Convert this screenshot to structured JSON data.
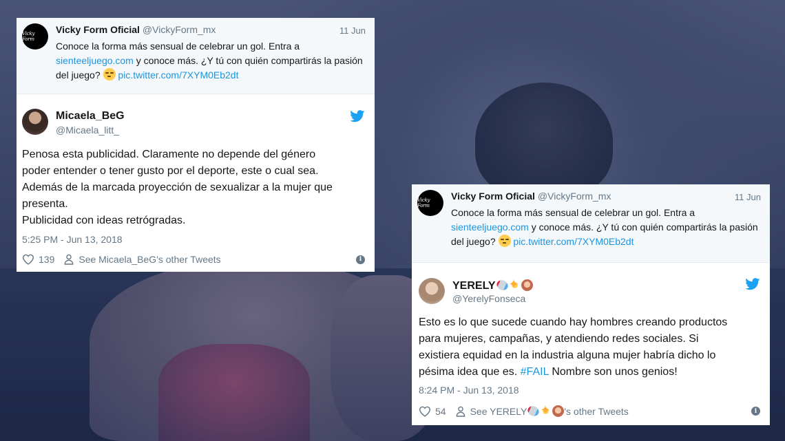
{
  "quoted_tweet": {
    "name": "Vicky Form Oficial",
    "handle": "@VickyForm_mx",
    "date": "11 Jun",
    "text_1": "Conoce la forma más sensual de celebrar un gol. Entra a",
    "link_1": "sienteeljuego.com",
    "text_2": " y conoce más. ¿Y tú con quién compartirás la pasión del juego? ",
    "link_2": "pic.twitter.com/7XYM0Eb2dt",
    "avatar_logo": "Vicky Form",
    "avatar_logo_accent": "Form"
  },
  "tweet_a": {
    "name": "Micaela_BeG",
    "handle": "@Micaela_litt_",
    "lines": [
      "Penosa esta publicidad. Claramente no depende del género",
      "poder entender o tener gusto por el deporte, este o cual sea.",
      "Además de la marcada proyección de sexualizar a la mujer que",
      "presenta.",
      "Publicidad con ideas retrógradas."
    ],
    "time": "5:25 PM - Jun 13, 2018",
    "likes": "139",
    "other_tweets": "See Micaela_BeG's other Tweets"
  },
  "tweet_b": {
    "name": "YERELY",
    "handle": "@YerelyFonseca",
    "line_1": "Esto es lo que sucede cuando hay hombres creando productos",
    "line_2": "para mujeres, campañas, y atendiendo redes sociales. Si",
    "line_3": "existiera equidad en la industria alguna mujer habría dicho lo",
    "line_4a": "pésima idea que es. ",
    "hashtag": "#FAIL",
    "line_4b": " Nombre son unos genios!",
    "time": "8:24 PM - Jun 13, 2018",
    "likes": "54",
    "other_tweets_prefix": "See YERELY",
    "other_tweets_suffix": "'s other Tweets"
  },
  "icons": {
    "bird": "twitter-bird-icon",
    "heart": "heart-icon",
    "person": "person-icon",
    "info": "info-icon",
    "info_glyph": "i"
  },
  "colors": {
    "link": "#1b95e0",
    "secondary_text": "#657786",
    "quoted_bg": "#f5f8fa"
  }
}
